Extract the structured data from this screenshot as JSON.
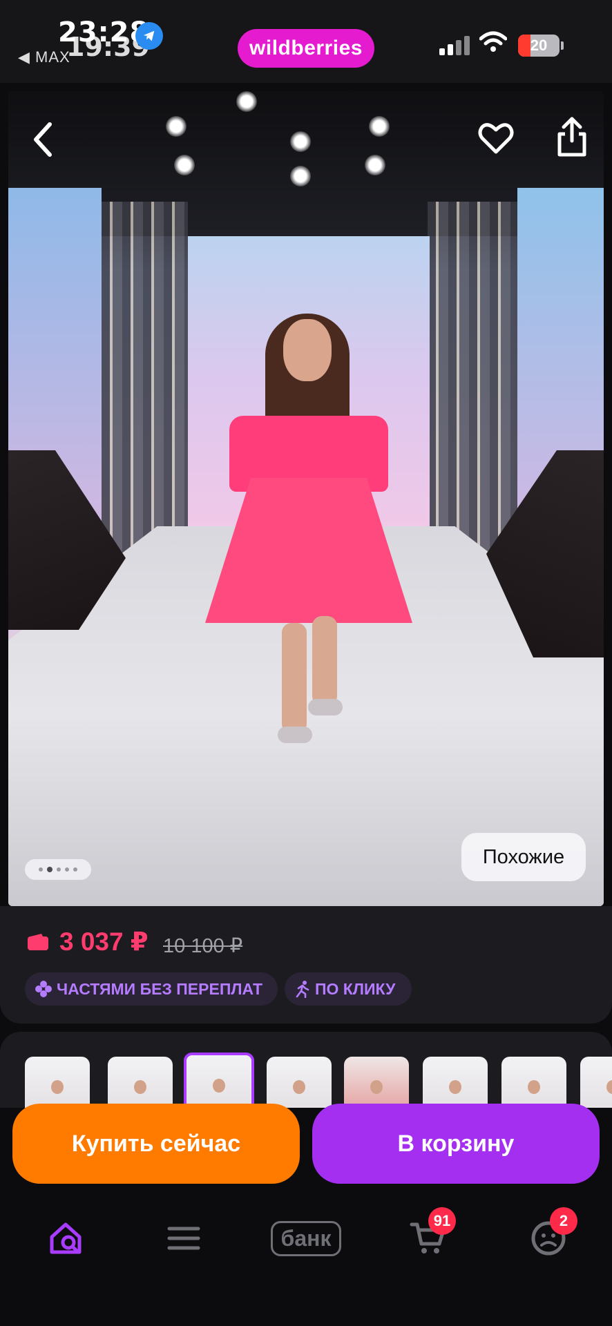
{
  "status_bar": {
    "time_primary": "23:28",
    "time_secondary": "19:39",
    "back_app_label": "◀ MAX",
    "battery_percent": "20",
    "brand_label": "wildberries"
  },
  "product": {
    "similar_label": "Похожие",
    "gallery_page_count": 5,
    "gallery_active_index": 1
  },
  "price": {
    "current": "3 037 ₽",
    "old": "10 100 ₽",
    "badges": [
      "ЧАСТЯМИ БЕЗ ПЕРЕПЛАТ",
      "ПО КЛИКУ"
    ]
  },
  "variants": {
    "count_visible": 8,
    "selected_index": 2
  },
  "actions": {
    "buy_now_label": "Купить сейчас",
    "add_to_cart_label": "В корзину"
  },
  "bottom_nav": {
    "bank_label": "банк",
    "cart_count": "91",
    "profile_count": "2"
  },
  "colors": {
    "brand": "#e51bd0",
    "price": "#ff3c6e",
    "buy_now": "#ff7b00",
    "cart": "#a52ff0",
    "accent": "#a93cff"
  },
  "icons": [
    "back-icon",
    "heart-icon",
    "share-icon",
    "wallet-icon",
    "clover-icon",
    "runner-icon",
    "home-search-icon",
    "menu-icon",
    "cart-icon",
    "profile-icon"
  ]
}
